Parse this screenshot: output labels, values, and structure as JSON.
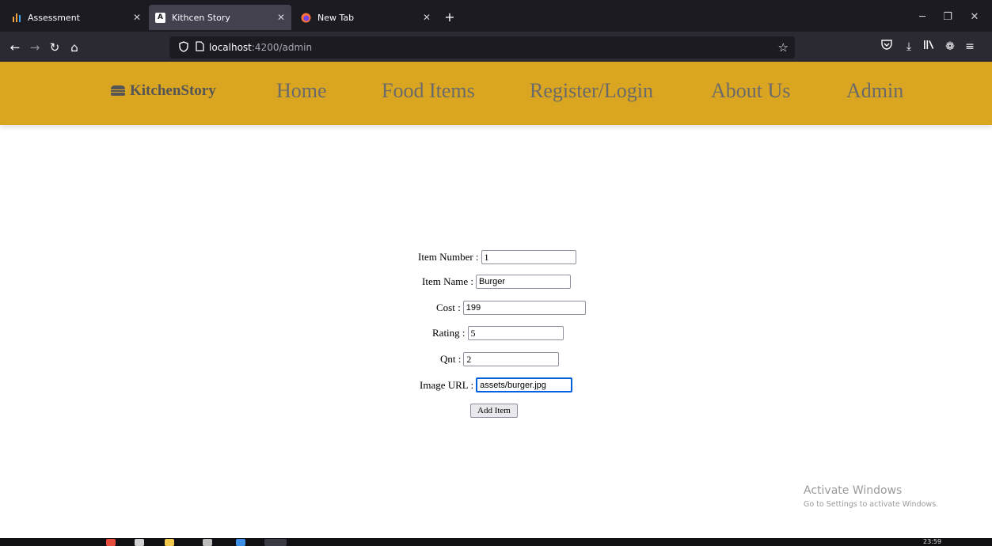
{
  "browser": {
    "tabs": [
      {
        "title": "Assessment",
        "icon": "chart-icon",
        "active": false
      },
      {
        "title": "Kithcen Story",
        "icon": "angular-icon",
        "active": true
      },
      {
        "title": "New Tab",
        "icon": "firefox-icon",
        "active": false
      }
    ],
    "url_host": "localhost",
    "url_path": ":4200/admin"
  },
  "app": {
    "brand": "KitchenStory",
    "nav": [
      "Home",
      "Food Items",
      "Register/Login",
      "About Us",
      "Admin"
    ]
  },
  "form": {
    "item_number": {
      "label": "Item Number :",
      "value": "1"
    },
    "item_name": {
      "label": "Item Name :",
      "value": "Burger"
    },
    "cost": {
      "label": "Cost :",
      "value": "199"
    },
    "rating": {
      "label": "Rating :",
      "value": "5"
    },
    "qnt": {
      "label": "Qnt :",
      "value": "2"
    },
    "image_url": {
      "label": "Image URL :",
      "value": "assets/burger.jpg"
    },
    "submit": "Add Item"
  },
  "watermark": {
    "title": "Activate Windows",
    "subtitle": "Go to Settings to activate Windows."
  },
  "taskbar": {
    "time": "23:59"
  },
  "colors": {
    "header": "#daa520",
    "tabbar": "#1c1b22",
    "toolbar": "#2b2a33",
    "focus": "#0060df"
  }
}
